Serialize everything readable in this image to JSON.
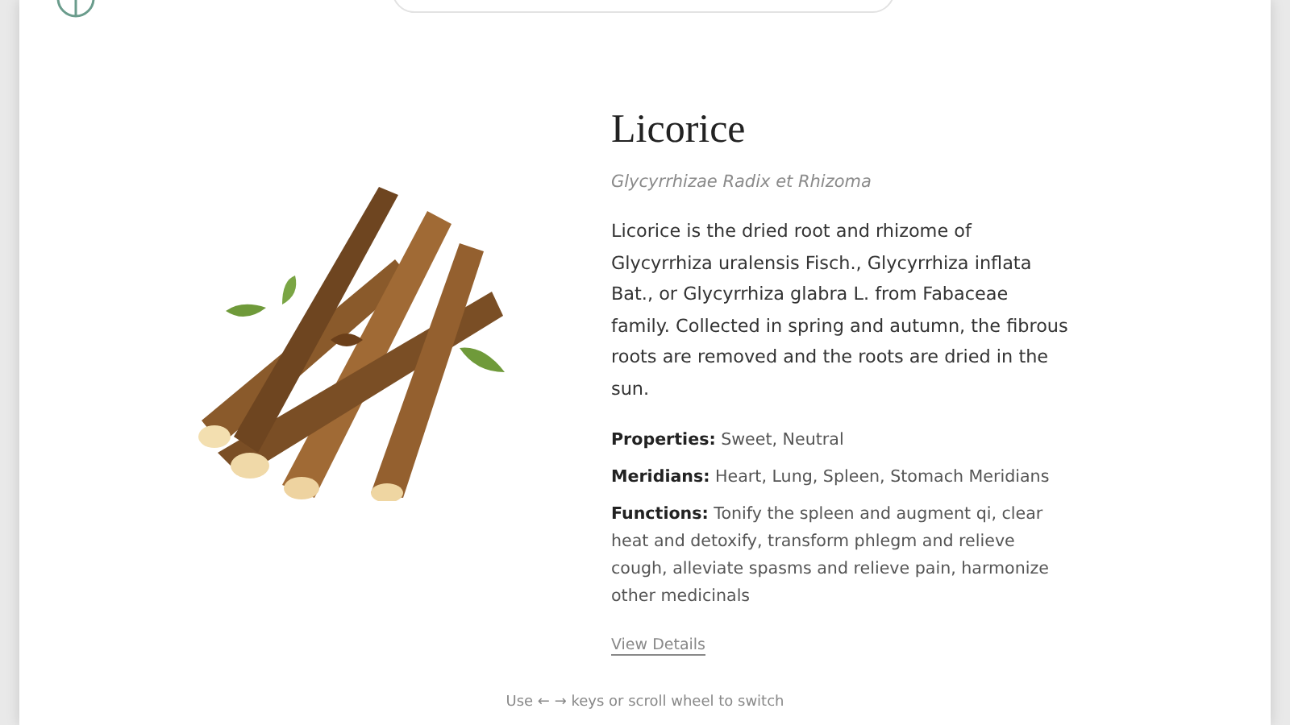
{
  "herb": {
    "name": "Licorice",
    "latin": "Glycyrrhizae Radix et Rhizoma",
    "description": "Licorice is the dried root and rhizome of Glycyrrhiza uralensis Fisch., Glycyrrhiza inflata Bat., or Glycyrrhiza glabra L. from Fabaceae family. Collected in spring and autumn, the fibrous roots are removed and the roots are dried in the sun.",
    "facts": [
      "**Properties:** Sweet, Neutral",
      "**Meridians:** Heart, Lung, Spleen, Stomach Meridians",
      "**Functions:** Tonify the spleen and augment qi, clear heat and detoxify, transform phlegm and relieve cough, alleviate spasms and relieve pain, harmonize other medicinals"
    ],
    "link": "View Details"
  },
  "hint": "Use ← → keys or scroll wheel to switch"
}
